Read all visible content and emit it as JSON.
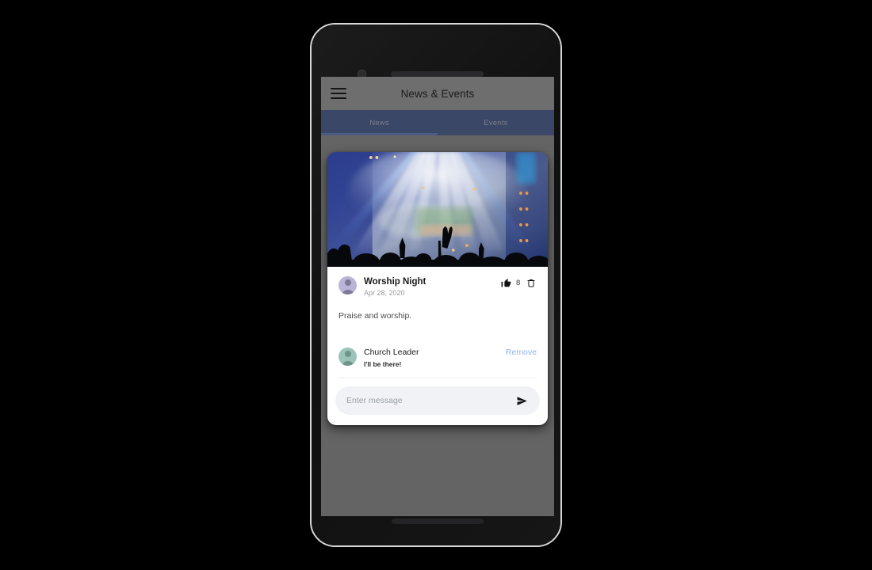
{
  "device": {
    "name": "android-phone",
    "camera_icon": "camera-dot",
    "speaker_icon": "earpiece-speaker",
    "home_bar_icon": "home-indicator"
  },
  "appbar": {
    "menu_icon": "hamburger-menu-icon",
    "title": "News & Events"
  },
  "tabs": [
    {
      "label": "News",
      "active": true
    },
    {
      "label": "Events",
      "active": false
    }
  ],
  "post": {
    "hero_image_alt": "concert-stage-lights",
    "avatar_icon": "user-avatar-purple",
    "title": "Worship Night",
    "date": "Apr 28, 2020",
    "like_icon": "thumbs-up-icon",
    "like_count": "8",
    "delete_icon": "trash-icon",
    "body": "Praise and worship."
  },
  "comments": [
    {
      "avatar_icon": "user-avatar-green",
      "name": "Church Leader",
      "text": "I'll be there!",
      "remove_label": "Remove"
    }
  ],
  "composer": {
    "placeholder": "Enter message",
    "value": "",
    "send_icon": "send-paper-plane-icon"
  },
  "colors": {
    "page_background": "#000000",
    "screen_background": "#646464",
    "appbar": "#6e6e6e",
    "tabbar": "#3a4767",
    "tab_indicator": "#4b5b82",
    "card": "#ffffff",
    "link": "#8fb2ee",
    "input_pill": "#f0f2f5"
  }
}
